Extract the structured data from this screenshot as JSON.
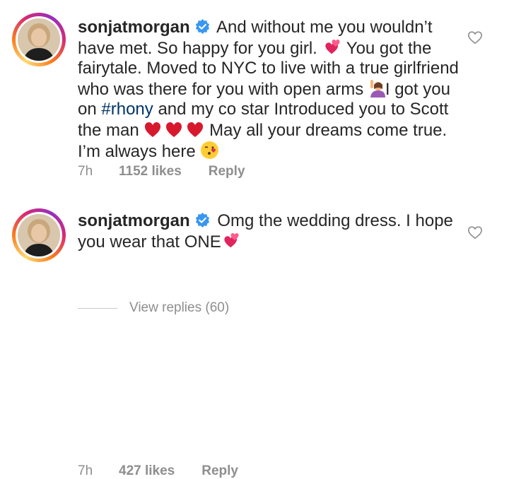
{
  "comments": [
    {
      "username": "sonjatmorgan",
      "text_parts": [
        "And without me you wouldn’t have met. So happy for you girl.",
        "You got the fairytale. Moved to NYC to live with a true girlfriend who was there for you with open arms",
        "I got you on",
        "and my co star Introduced you to Scott the man",
        "May all your dreams come true. I’m always here"
      ],
      "hashtag": "#rhony",
      "time": "7h",
      "likes": "1152 likes",
      "reply_label": "Reply"
    },
    {
      "username": "sonjatmorgan",
      "text_parts": [
        "Omg the wedding dress.  I hope you wear that ONE"
      ],
      "time": "7h",
      "likes": "427 likes",
      "reply_label": "Reply"
    }
  ],
  "view_replies": "View replies (60)",
  "icons": {
    "verified": "verified-badge-icon",
    "like": "heart-outline-icon",
    "emojis": [
      "two-hearts",
      "person-raising-hand",
      "heart-exclamation",
      "face-blowing-kiss",
      "two-hearts"
    ]
  },
  "colors": {
    "verified": "#3897f0",
    "hashtag": "#003569",
    "meta": "#8e8e8e",
    "heart_emoji": "#e0245e"
  }
}
